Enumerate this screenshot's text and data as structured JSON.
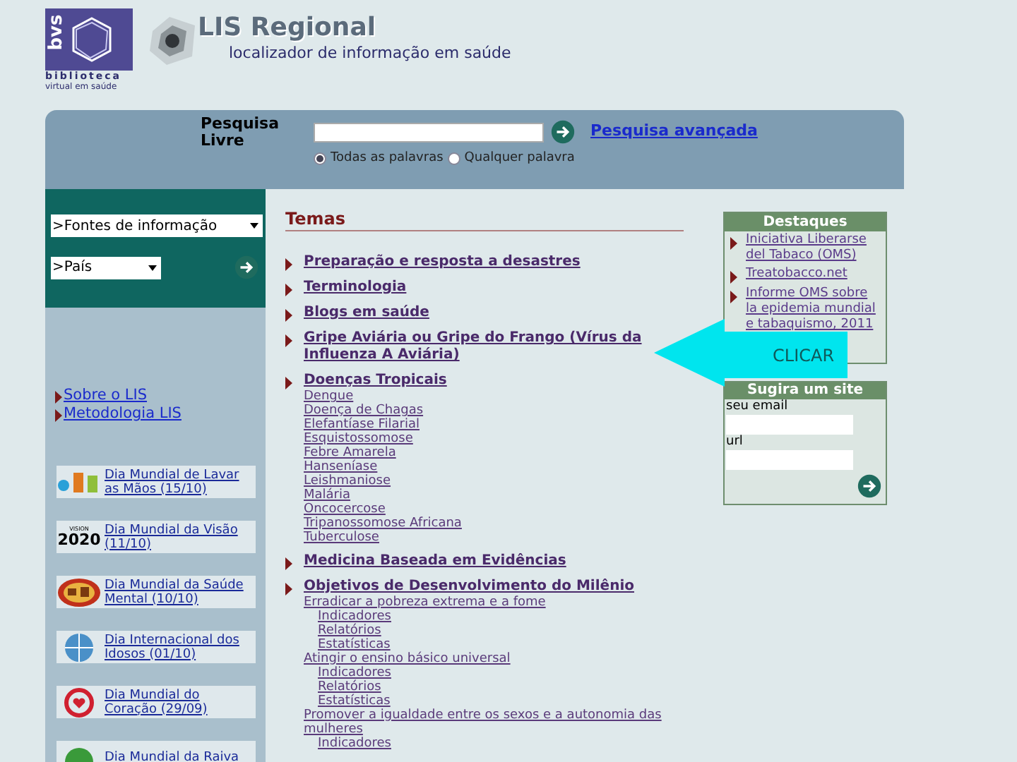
{
  "logo": {
    "letters": "bvs",
    "line1": "biblioteca",
    "line2": "virtual em saúde"
  },
  "brand": {
    "title": "LIS Regional",
    "subtitle": "localizador de informação em saúde"
  },
  "search": {
    "label": "Pesquisa Livre",
    "advanced": "Pesquisa avançada",
    "options": [
      {
        "label": "Todas as palavras",
        "selected": true
      },
      {
        "label": "Qualquer palavra",
        "selected": false
      }
    ]
  },
  "sidebar": {
    "selects": [
      ">Fontes de informação",
      ">País"
    ],
    "links": [
      "Sobre o LIS",
      "Metodologia LIS"
    ],
    "events": [
      {
        "kind": "hands",
        "label": "Dia Mundial de Lavar as Mãos (15/10)"
      },
      {
        "kind": "vision",
        "label": "Dia Mundial da Visão (11/10)",
        "badge_top": "VISION",
        "badge_main": "2020"
      },
      {
        "kind": "globe",
        "label": "Dia Mundial da Saúde Mental (10/10)"
      },
      {
        "kind": "who",
        "label": "Dia Internacional dos Idosos (01/10)"
      },
      {
        "kind": "heart",
        "label": "Dia Mundial do Coração (29/09)"
      },
      {
        "kind": "earth",
        "label": "Dia Mundial da Raiva"
      }
    ]
  },
  "temas": {
    "title": "Temas",
    "items": [
      {
        "label": "Preparação e resposta a desastres"
      },
      {
        "label": "Terminologia"
      },
      {
        "label": "Blogs em saúde"
      },
      {
        "label": "Gripe Aviária ou Gripe do Frango (Vírus da Influenza A Aviária)"
      },
      {
        "label": "Doenças Tropicais",
        "children": [
          {
            "label": "Dengue"
          },
          {
            "label": "Doença de Chagas"
          },
          {
            "label": "Elefantíase Filarial"
          },
          {
            "label": "Esquistossomose"
          },
          {
            "label": "Febre Amarela"
          },
          {
            "label": "Hanseníase"
          },
          {
            "label": "Leishmaniose"
          },
          {
            "label": "Malária"
          },
          {
            "label": "Oncocercose"
          },
          {
            "label": "Tripanossomose Africana"
          },
          {
            "label": "Tuberculose"
          }
        ]
      },
      {
        "label": "Medicina Baseada em Evidências"
      },
      {
        "label": "Objetivos de Desenvolvimento do Milênio",
        "children": [
          {
            "label": "Erradicar a pobreza extrema e a fome",
            "children": [
              {
                "label": "Indicadores"
              },
              {
                "label": "Relatórios"
              },
              {
                "label": "Estatísticas"
              }
            ]
          },
          {
            "label": "Atingir o ensino básico universal",
            "children": [
              {
                "label": "Indicadores"
              },
              {
                "label": "Relatórios"
              },
              {
                "label": "Estatísticas"
              }
            ]
          },
          {
            "label": "Promover a igualdade entre os sexos e a autonomia das mulheres",
            "children": [
              {
                "label": "Indicadores"
              }
            ]
          }
        ]
      }
    ]
  },
  "destaques": {
    "title": "Destaques",
    "items": [
      "Iniciativa Liberarse del Tabaco (OMS)",
      "Treatobacco.net",
      "Informe OMS sobre la epidemia mundial e tabaquismo, 2011"
    ]
  },
  "suggest": {
    "title": "Sugira um site",
    "fields": [
      {
        "label": "seu email"
      },
      {
        "label": "url"
      }
    ]
  },
  "callout": {
    "label": "CLICAR"
  }
}
